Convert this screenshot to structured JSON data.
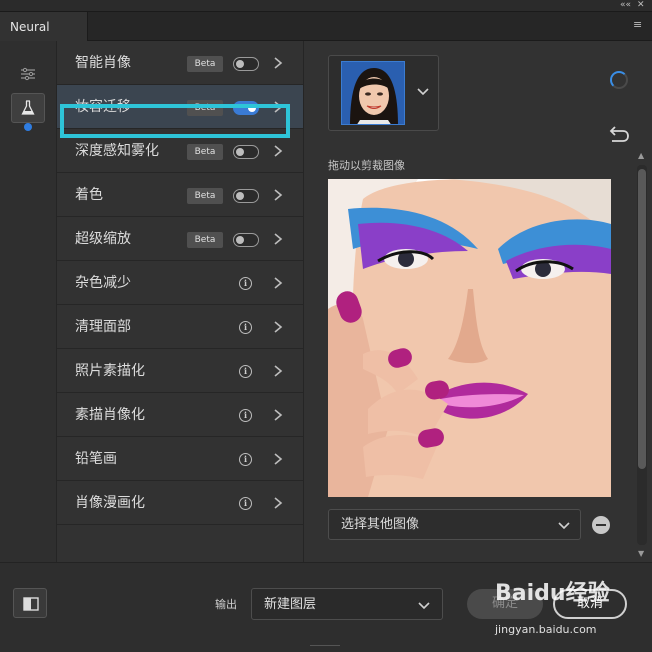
{
  "window": {
    "collapse_glyph": "««",
    "close_glyph": "✕",
    "menu_glyph": "≡"
  },
  "tabs": [
    {
      "label": "Neural Filters"
    }
  ],
  "rail": {
    "icons": [
      "sliders-icon",
      "flask-icon"
    ]
  },
  "filters": [
    {
      "label": "智能肖像",
      "badge": "Beta",
      "control": "toggle",
      "on": false
    },
    {
      "label": "妆容迁移",
      "badge": "Beta",
      "control": "toggle",
      "on": true,
      "selected": true
    },
    {
      "label": "深度感知雾化",
      "badge": "Beta",
      "control": "toggle",
      "on": false
    },
    {
      "label": "着色",
      "badge": "Beta",
      "control": "toggle",
      "on": false
    },
    {
      "label": "超级缩放",
      "badge": "Beta",
      "control": "toggle",
      "on": false
    },
    {
      "label": "杂色减少",
      "control": "info"
    },
    {
      "label": "清理面部",
      "control": "info"
    },
    {
      "label": "照片素描化",
      "control": "info"
    },
    {
      "label": "素描肖像化",
      "control": "info"
    },
    {
      "label": "铅笔画",
      "control": "info"
    },
    {
      "label": "肖像漫画化",
      "control": "info"
    }
  ],
  "detail": {
    "caption": "拖动以剪裁图像",
    "select_image_label": "选择其他图像"
  },
  "footer": {
    "output_label": "输出",
    "output_value": "新建图层",
    "ok_label": "确定",
    "cancel_label": "取消"
  },
  "watermark": {
    "logo_text": "Baidu经验",
    "url": "jingyan.baidu.com"
  },
  "colors": {
    "accent": "#3a7bd5",
    "highlight": "#2ec4d8"
  }
}
